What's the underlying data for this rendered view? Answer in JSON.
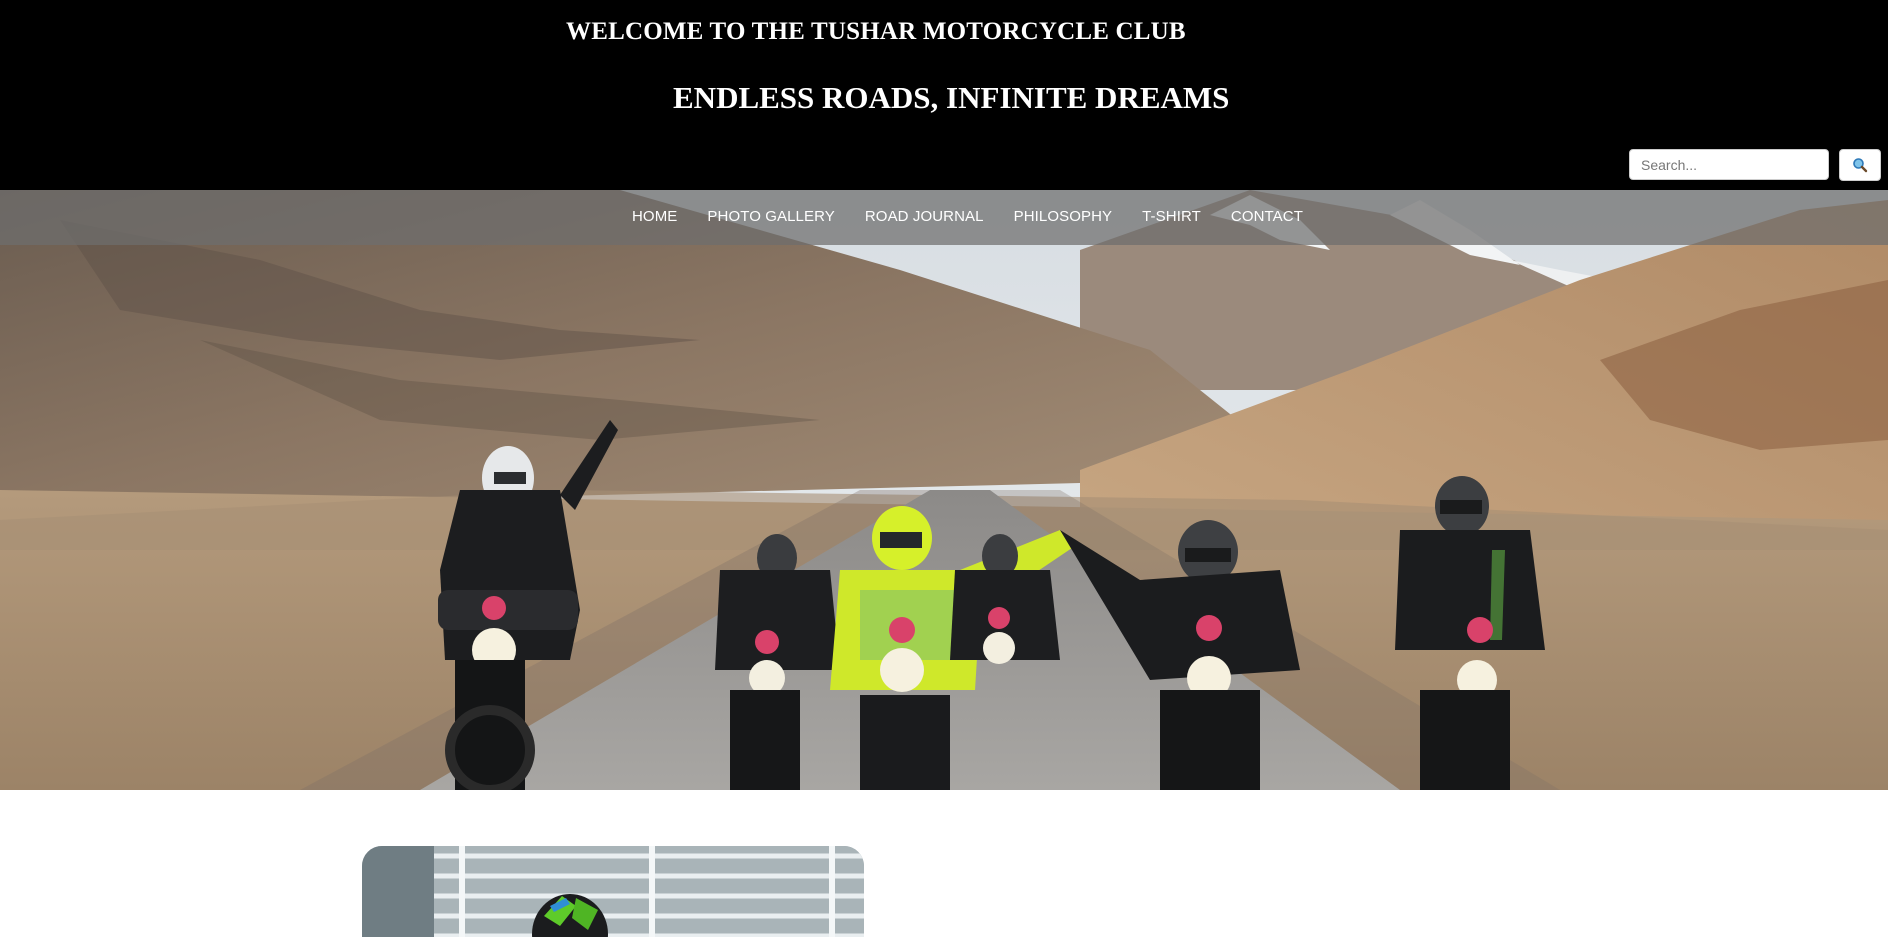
{
  "header": {
    "welcome": "WELCOME TO THE TUSHAR MOTORCYCLE CLUB",
    "tagline": "ENDLESS ROADS, INFINITE DREAMS"
  },
  "search": {
    "placeholder": "Search...",
    "value": "",
    "button_icon": "magnifier-icon"
  },
  "nav": {
    "items": [
      "HOME",
      "PHOTO GALLERY",
      "ROAD JOURNAL",
      "PHILOSOPHY",
      "T-SHIRT",
      "CONTACT"
    ]
  },
  "colors": {
    "header_bg": "#000000",
    "header_text": "#ffffff",
    "nav_bg": "rgba(110,110,110,0.72)",
    "helmet_accent": "#d6f02a",
    "page_bg": "#ffffff"
  }
}
